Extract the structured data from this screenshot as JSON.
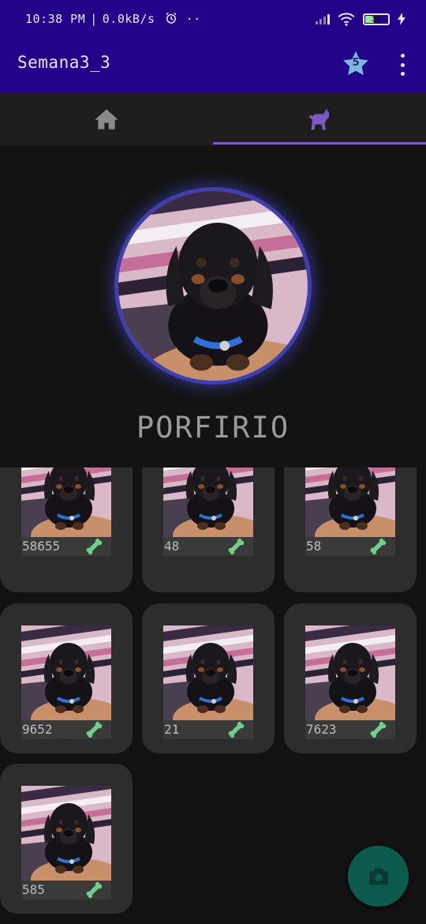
{
  "status_bar": {
    "time": "10:38 PM",
    "network_speed": "0.0kB/s",
    "icons": [
      "alarm-icon",
      "more-notifications-icon",
      "signal-icon",
      "wifi-icon",
      "battery-icon",
      "charging-icon"
    ],
    "battery_level": "38"
  },
  "app_bar": {
    "title": "Semana3_3",
    "favorites_count": "5",
    "icons": [
      "star-icon",
      "more-vert-icon"
    ]
  },
  "tabs": [
    {
      "icon": "home-icon",
      "selected": false
    },
    {
      "icon": "dog-icon",
      "selected": true
    }
  ],
  "profile": {
    "name": "PORFIRIO"
  },
  "gallery": {
    "items": [
      {
        "likes": "58655",
        "icon": "bone-icon"
      },
      {
        "likes": "48",
        "icon": "bone-icon"
      },
      {
        "likes": "58",
        "icon": "bone-icon"
      },
      {
        "likes": "9652",
        "icon": "bone-icon"
      },
      {
        "likes": "21",
        "icon": "bone-icon"
      },
      {
        "likes": "7623",
        "icon": "bone-icon"
      },
      {
        "likes": "585",
        "icon": "bone-icon"
      }
    ]
  },
  "fab": {
    "icon": "camera-icon"
  },
  "colors": {
    "app_bar": "#24038b",
    "tab_indicator": "#7e57c2",
    "avatar_ring": "#3f3fb0",
    "bone": "#6fcf8a",
    "fab": "#0d5b4f",
    "star": "#7fb6e0"
  }
}
